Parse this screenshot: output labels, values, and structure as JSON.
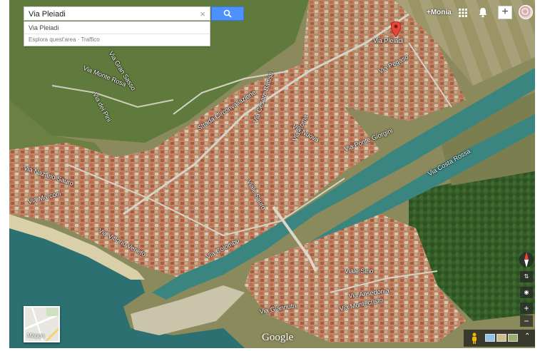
{
  "search": {
    "value": "Via Pleiadi",
    "clear_glyph": "×",
    "suggestion_title": "Via Pleiadi",
    "suggestion_links": [
      "Esplora quest'area",
      "Traffico"
    ],
    "suggestion_separator": " · "
  },
  "topbar": {
    "account": "+Monia",
    "plus": "+"
  },
  "map": {
    "labels": [
      "Via Pleiadi",
      "Via Pegaso",
      "Strada Circonvallazione",
      "Via Monte Rosa",
      "Via Gran Sasso",
      "Via dei Pini",
      "Via Nazario Sauro",
      "Via Marconi",
      "Via Cesare Battisti",
      "Via Roma",
      "Via Nuova",
      "Via Ponte Giorgini",
      "Via Costa Rossa",
      "Viale Sauro",
      "Via Colombo",
      "Via Vittorio Veneto",
      "Viale Sirio",
      "Via Ansedonia",
      "Via Montecristo",
      "Via Giannutri"
    ]
  },
  "map_type": {
    "label": "Mappa"
  },
  "logo": "Google",
  "controls": {
    "zoom_in": "+",
    "zoom_out": "−",
    "expand": "⌃"
  },
  "icons": [
    "search-icon",
    "close-icon",
    "apps-icon",
    "bell-icon",
    "plus-icon",
    "avatar",
    "compass-icon",
    "pegman-icon",
    "expand-icon",
    "location-pin-icon"
  ],
  "colors": {
    "search_button": "#4d90fe",
    "pin": "#e8463b",
    "sea": "#2d7072",
    "channel": "#3a8580"
  }
}
